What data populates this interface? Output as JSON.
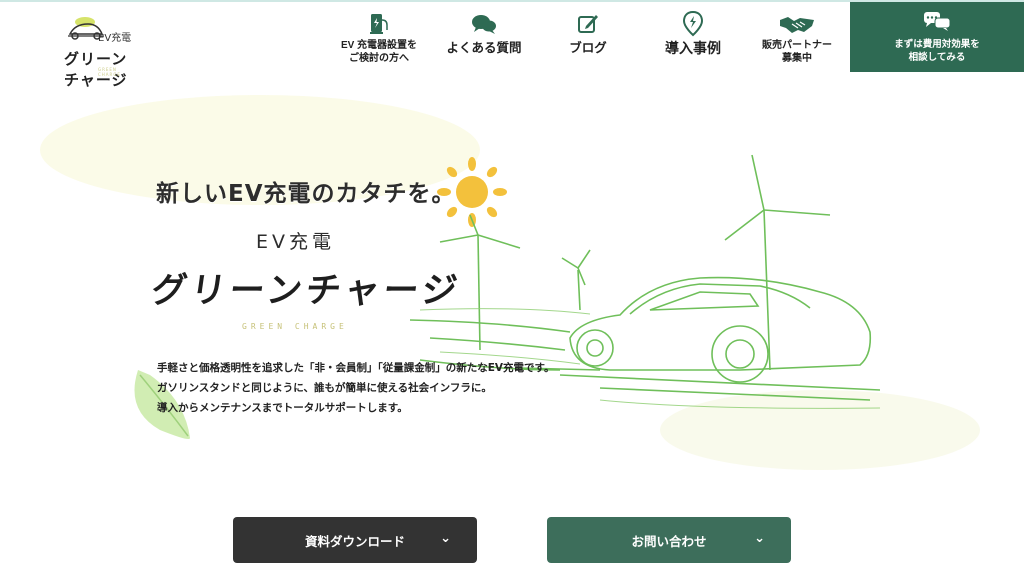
{
  "logo": {
    "top_text": "EV充電",
    "name": "グリーンチャージ",
    "tiny": "GREEN CHARGE"
  },
  "nav": {
    "items": [
      {
        "label": "EV 充電器設置を\nご検討の方へ",
        "icon": "charger-icon"
      },
      {
        "label": "よくある質問",
        "icon": "chat-icon"
      },
      {
        "label": "ブログ",
        "icon": "pen-icon"
      },
      {
        "label": "導入事例",
        "icon": "location-pin-icon"
      },
      {
        "label": "販売パートナー\n募集中",
        "icon": "handshake-icon"
      }
    ],
    "cta": {
      "label": "まずは費用対効果を\n相談してみる",
      "icon": "speech-bubbles-icon"
    }
  },
  "hero": {
    "tagline": "新しいEV充電のカタチを。",
    "brand_ev": "EV充電",
    "brand_name": "グリーンチャージ",
    "brand_en": "GREEN CHARGE",
    "desc_lines": [
      "手軽さと価格透明性を追求した「非・会員制」「従量課金制」の新たなEV充電です。",
      "ガソリンスタンドと同じように、誰もが簡単に使える社会インフラに。",
      "導入からメンテナンスまでトータルサポートします。"
    ]
  },
  "buttons": {
    "download": "資料ダウンロード",
    "contact": "お問い合わせ",
    "chevron": "⌄"
  },
  "colors": {
    "brand_green": "#2e6a53",
    "contact_green": "#3d6e5b",
    "dark_button": "#333333",
    "line_green": "#6fbf5a",
    "sun": "#f3c13c"
  }
}
